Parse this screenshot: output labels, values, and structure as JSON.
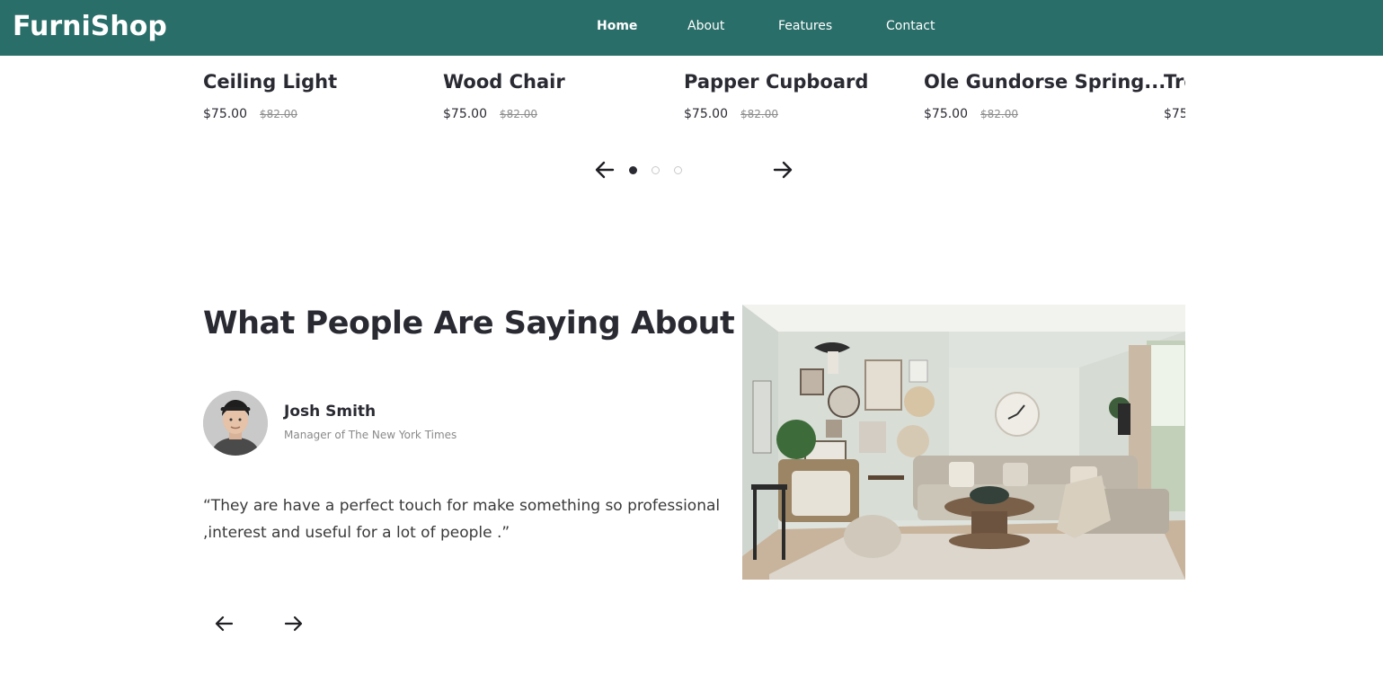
{
  "header": {
    "logo": "FurniShop",
    "nav": [
      "Home",
      "About",
      "Features",
      "Contact"
    ],
    "active_nav": "Home"
  },
  "products": [
    {
      "name": "Ceiling Light",
      "price": "$75.00",
      "old_price": "$82.00"
    },
    {
      "name": "Wood Chair",
      "price": "$75.00",
      "old_price": "$82.00"
    },
    {
      "name": "Papper Cupboard",
      "price": "$75.00",
      "old_price": "$82.00"
    },
    {
      "name": "Ole Gundorse Spring...",
      "price": "$75.00",
      "old_price": "$82.00"
    },
    {
      "name": "Tre",
      "price": "$75",
      "old_price": ""
    }
  ],
  "product_carousel": {
    "prev_icon": "arrow-left-icon",
    "next_icon": "arrow-right-icon",
    "page_count": 3,
    "active_page": 1
  },
  "testimonial": {
    "title": "What People Are Saying About Us",
    "author_name": "Josh Smith",
    "author_role": "Manager of The New York Times",
    "quote": "“They are have a perfect touch for make something so professional ,interest and useful for a lot of people .”",
    "prev_icon": "arrow-left-icon",
    "next_icon": "arrow-right-icon"
  },
  "colors": {
    "brand": "#2a6e69",
    "text_dark": "#2a2a33",
    "muted": "#8a8a8a"
  }
}
